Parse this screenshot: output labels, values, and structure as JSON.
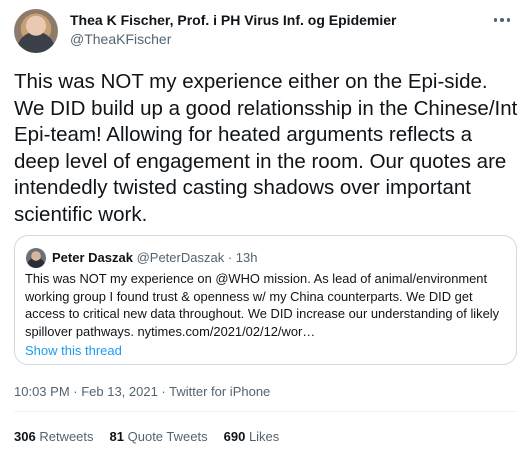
{
  "author": {
    "name": "Thea K Fischer, Prof. i PH Virus Inf. og Epidemier",
    "handle": "@TheaKFischer"
  },
  "tweet": {
    "text": "This was NOT my experience either on the Epi-side. We DID build up a good relationsship in the Chinese/Int Epi-team! Allowing for heated arguments reflects a deep level of engagement in the room. Our quotes are intendedly twisted casting shadows over important scientific work."
  },
  "quoted_tweet": {
    "name": "Peter Daszak",
    "handle": "@PeterDaszak",
    "separator": "·",
    "time": "13h",
    "text": "This was NOT my experience on @WHO mission. As lead of animal/environment working group I found trust & openness w/ my China counterparts. We DID get access to critical new data throughout. We DID increase our understanding of likely spillover pathways. nytimes.com/2021/02/12/wor…",
    "show_thread": "Show this thread"
  },
  "timestamp": "10:03 PM · Feb 13, 2021 · Twitter for iPhone",
  "stats": {
    "retweets_count": "306",
    "retweets_label": "Retweets",
    "quote_tweets_count": "81",
    "quote_tweets_label": "Quote Tweets",
    "likes_count": "690",
    "likes_label": "Likes"
  },
  "icons": {
    "more": "more-horizontal-icon"
  },
  "colors": {
    "link": "#1d9bf0",
    "secondary_text": "#536471",
    "primary_text": "#0f1419",
    "border": "#cfd9de"
  }
}
